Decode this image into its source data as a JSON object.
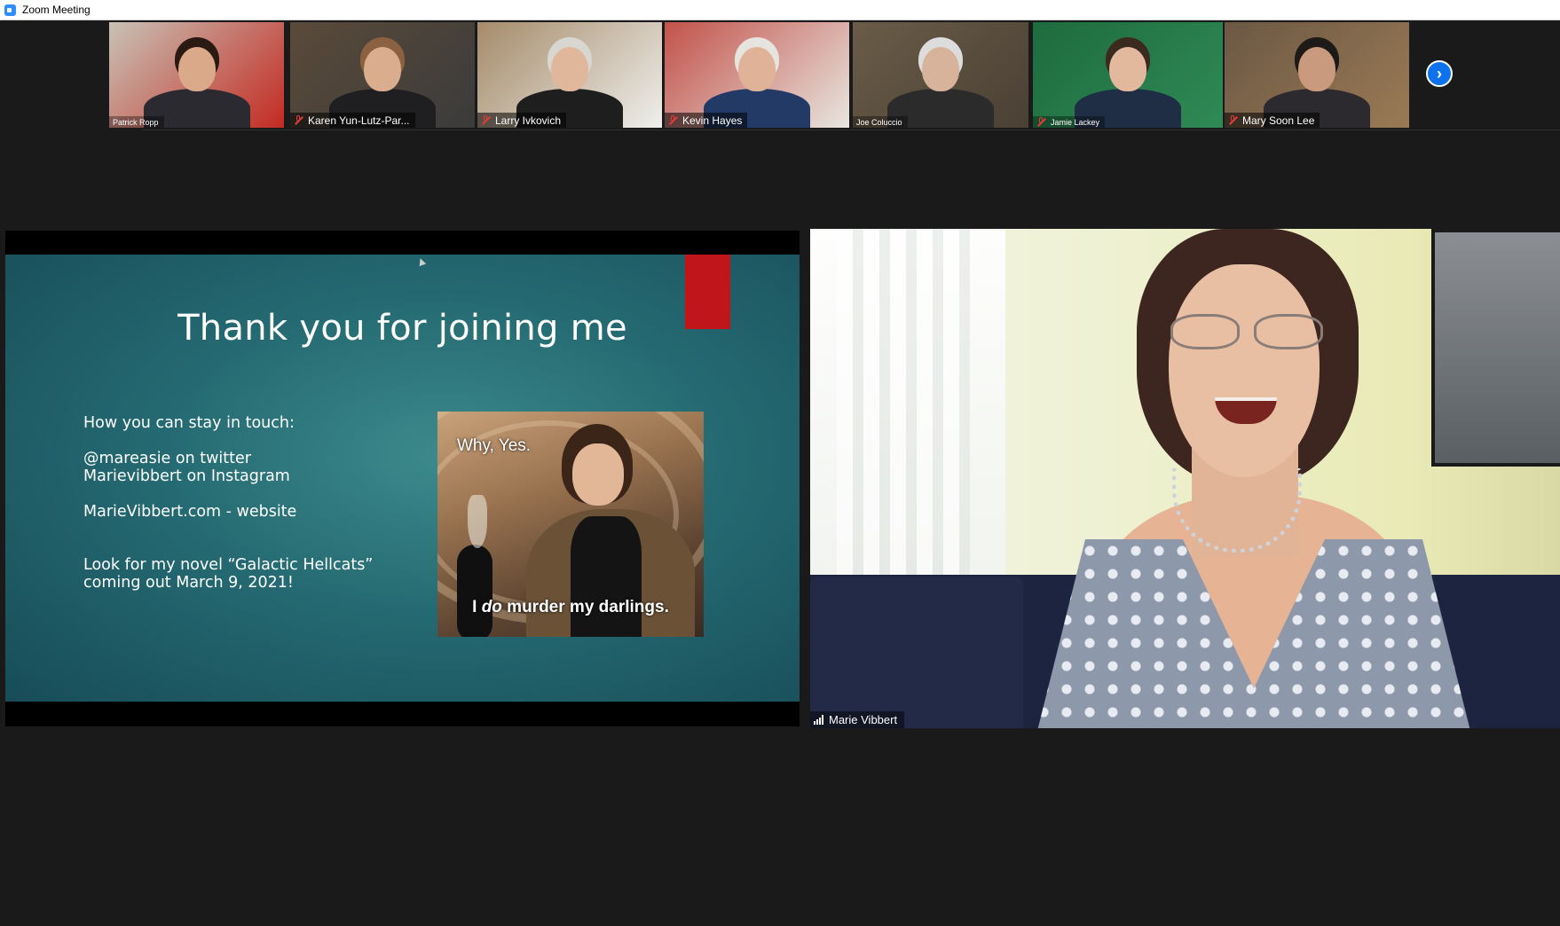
{
  "window": {
    "title": "Zoom Meeting"
  },
  "participants": [
    {
      "name": "Patrick Ropp",
      "muted": false,
      "label_style": "small",
      "bg": "#c9c2b6",
      "shirt": "#2a2a30",
      "skin": "#d9a98a",
      "hair": "#2a1a12",
      "accent": "#c32a22"
    },
    {
      "name": "Karen Yun-Lutz-Par...",
      "muted": true,
      "label_style": "normal",
      "bg": "#5a4a3a",
      "shirt": "#1f1f22",
      "skin": "#d9ad8e",
      "hair": "#8a6242",
      "accent": "#3b3b3b"
    },
    {
      "name": "Larry Ivkovich",
      "muted": true,
      "label_style": "normal",
      "bg": "#a58b6a",
      "shirt": "#1e1e1e",
      "skin": "#e1b79b",
      "hair": "#d8d6d0",
      "accent": "#efefec"
    },
    {
      "name": "Kevin Hayes",
      "muted": true,
      "label_style": "normal",
      "bg": "#c2524a",
      "shirt": "#233a66",
      "skin": "#e0b399",
      "hair": "#e6e4de",
      "accent": "#e8e6e0"
    },
    {
      "name": "Joe Coluccio",
      "muted": false,
      "label_style": "small",
      "bg": "#6a5c48",
      "shirt": "#2b2b2b",
      "skin": "#d6b39a",
      "hair": "#dcdcdc",
      "accent": "#4a4034"
    },
    {
      "name": "Jamie Lackey",
      "muted": true,
      "label_style": "small",
      "bg": "#1e6b3e",
      "shirt": "#1f2e44",
      "skin": "#e3b99e",
      "hair": "#3a2a20",
      "accent": "#2f8a55"
    },
    {
      "name": "Mary  Soon Lee",
      "muted": true,
      "label_style": "normal",
      "bg": "#6b5844",
      "shirt": "#2c2a2e",
      "skin": "#c99a7d",
      "hair": "#1e1a18",
      "accent": "#9a7a55"
    }
  ],
  "slide": {
    "title": "Thank you for joining me",
    "lines": [
      "How you can stay in touch:",
      "",
      "@mareasie on twitter",
      "Marievibbert on Instagram",
      "",
      "MarieVibbert.com  - website",
      "",
      "",
      "Look for my novel “Galactic Hellcats”",
      "coming out March 9, 2021!"
    ],
    "meme_top": "Why, Yes.",
    "meme_bottom_pre": "I ",
    "meme_bottom_em": "do",
    "meme_bottom_post": " murder my darlings.",
    "tools": [
      "prev-arrow",
      "pen",
      "menu",
      "next-arrow"
    ]
  },
  "speaker": {
    "name": "Marie Vibbert"
  },
  "colors": {
    "accent": "#0e72ed",
    "slide_red": "#c0161b",
    "mute_red": "#e23b3b"
  }
}
